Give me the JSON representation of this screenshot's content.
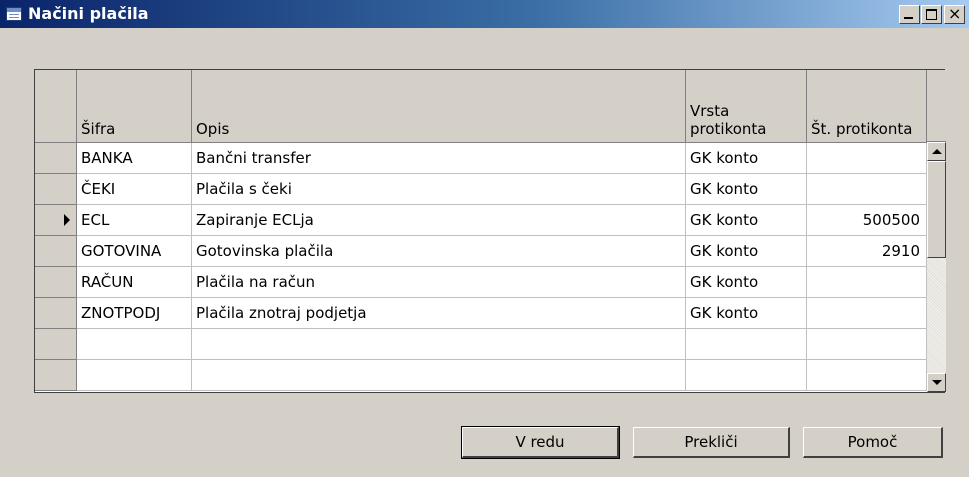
{
  "window": {
    "title": "Načini plačila"
  },
  "grid": {
    "columns": [
      {
        "label": "Šifra"
      },
      {
        "label": "Opis"
      },
      {
        "label": "Vrsta protikonta"
      },
      {
        "label": "Št. protikonta"
      }
    ],
    "rows": [
      {
        "code": "BANKA",
        "description": "Bančni transfer",
        "account_type": "GK konto",
        "account_no": ""
      },
      {
        "code": "ČEKI",
        "description": "Plačila s čeki",
        "account_type": "GK konto",
        "account_no": ""
      },
      {
        "code": "ECL",
        "description": "Zapiranje ECLja",
        "account_type": "GK konto",
        "account_no": "500500"
      },
      {
        "code": "GOTOVINA",
        "description": "Gotovinska plačila",
        "account_type": "GK konto",
        "account_no": "2910"
      },
      {
        "code": "RAČUN",
        "description": "Plačila na račun",
        "account_type": "GK konto",
        "account_no": ""
      },
      {
        "code": "ZNOTPODJ",
        "description": "Plačila znotraj podjetja",
        "account_type": "GK konto",
        "account_no": ""
      },
      {
        "code": "",
        "description": "",
        "account_type": "",
        "account_no": ""
      },
      {
        "code": "",
        "description": "",
        "account_type": "",
        "account_no": ""
      }
    ],
    "current_row": 2
  },
  "buttons": {
    "ok": "V redu",
    "cancel": "Prekliči",
    "help": "Pomoč"
  },
  "icons": {
    "app": "table-icon",
    "minimize": "minimize-icon",
    "maximize": "maximize-icon",
    "close": "close-icon"
  }
}
